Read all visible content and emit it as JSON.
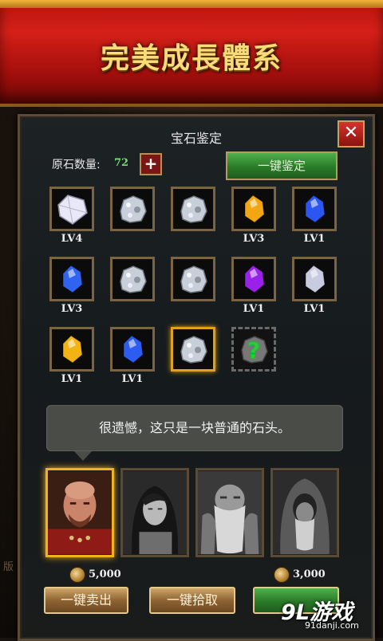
{
  "banner": {
    "title": "完美成長體系"
  },
  "panel": {
    "title": "宝石鉴定",
    "ore_label": "原石数量:",
    "ore_count": "72",
    "plus_label": "+",
    "identify_all_label": "一键鉴定",
    "close_label": "✕"
  },
  "gems": [
    {
      "kind": "diamond",
      "color": "#e8e8f8",
      "level": "LV4"
    },
    {
      "kind": "ore",
      "color": "#c9cfd8",
      "level": ""
    },
    {
      "kind": "ore",
      "color": "#c9cfd8",
      "level": ""
    },
    {
      "kind": "crystal",
      "color": "#f2a614",
      "level": "LV3"
    },
    {
      "kind": "crystal",
      "color": "#2d55f0",
      "level": "LV1"
    },
    {
      "kind": "crystal",
      "color": "#2f63f0",
      "level": "LV3"
    },
    {
      "kind": "ore",
      "color": "#c9cfd8",
      "level": ""
    },
    {
      "kind": "ore",
      "color": "#c9cfd8",
      "level": ""
    },
    {
      "kind": "crystal",
      "color": "#9a22e8",
      "level": "LV1"
    },
    {
      "kind": "crystal",
      "color": "#c9cbe0",
      "level": "LV1"
    },
    {
      "kind": "crystal",
      "color": "#f2b414",
      "level": "LV1"
    },
    {
      "kind": "crystal",
      "color": "#2d5cf0",
      "level": "LV1"
    },
    {
      "kind": "ore",
      "color": "#c9cfd8",
      "level": "",
      "selected": true
    },
    {
      "kind": "unknown",
      "color": "#3ac43a",
      "level": ""
    }
  ],
  "bubble": {
    "text": "很遗憾，这只是一块普通的石头。"
  },
  "appraisers": [
    {
      "name": "bald-warrior",
      "selected": true
    },
    {
      "name": "dark-haired-woman",
      "selected": false
    },
    {
      "name": "old-dwarf",
      "selected": false
    },
    {
      "name": "hooded-elder",
      "selected": false
    }
  ],
  "prices": {
    "first": "5,000",
    "fourth": "3,000"
  },
  "buttons": {
    "sell_all": "一键卖出",
    "pick_all": "一键拾取"
  },
  "watermark": {
    "main": "9L游戏",
    "sub": "91danji.com"
  },
  "side_text": "版"
}
